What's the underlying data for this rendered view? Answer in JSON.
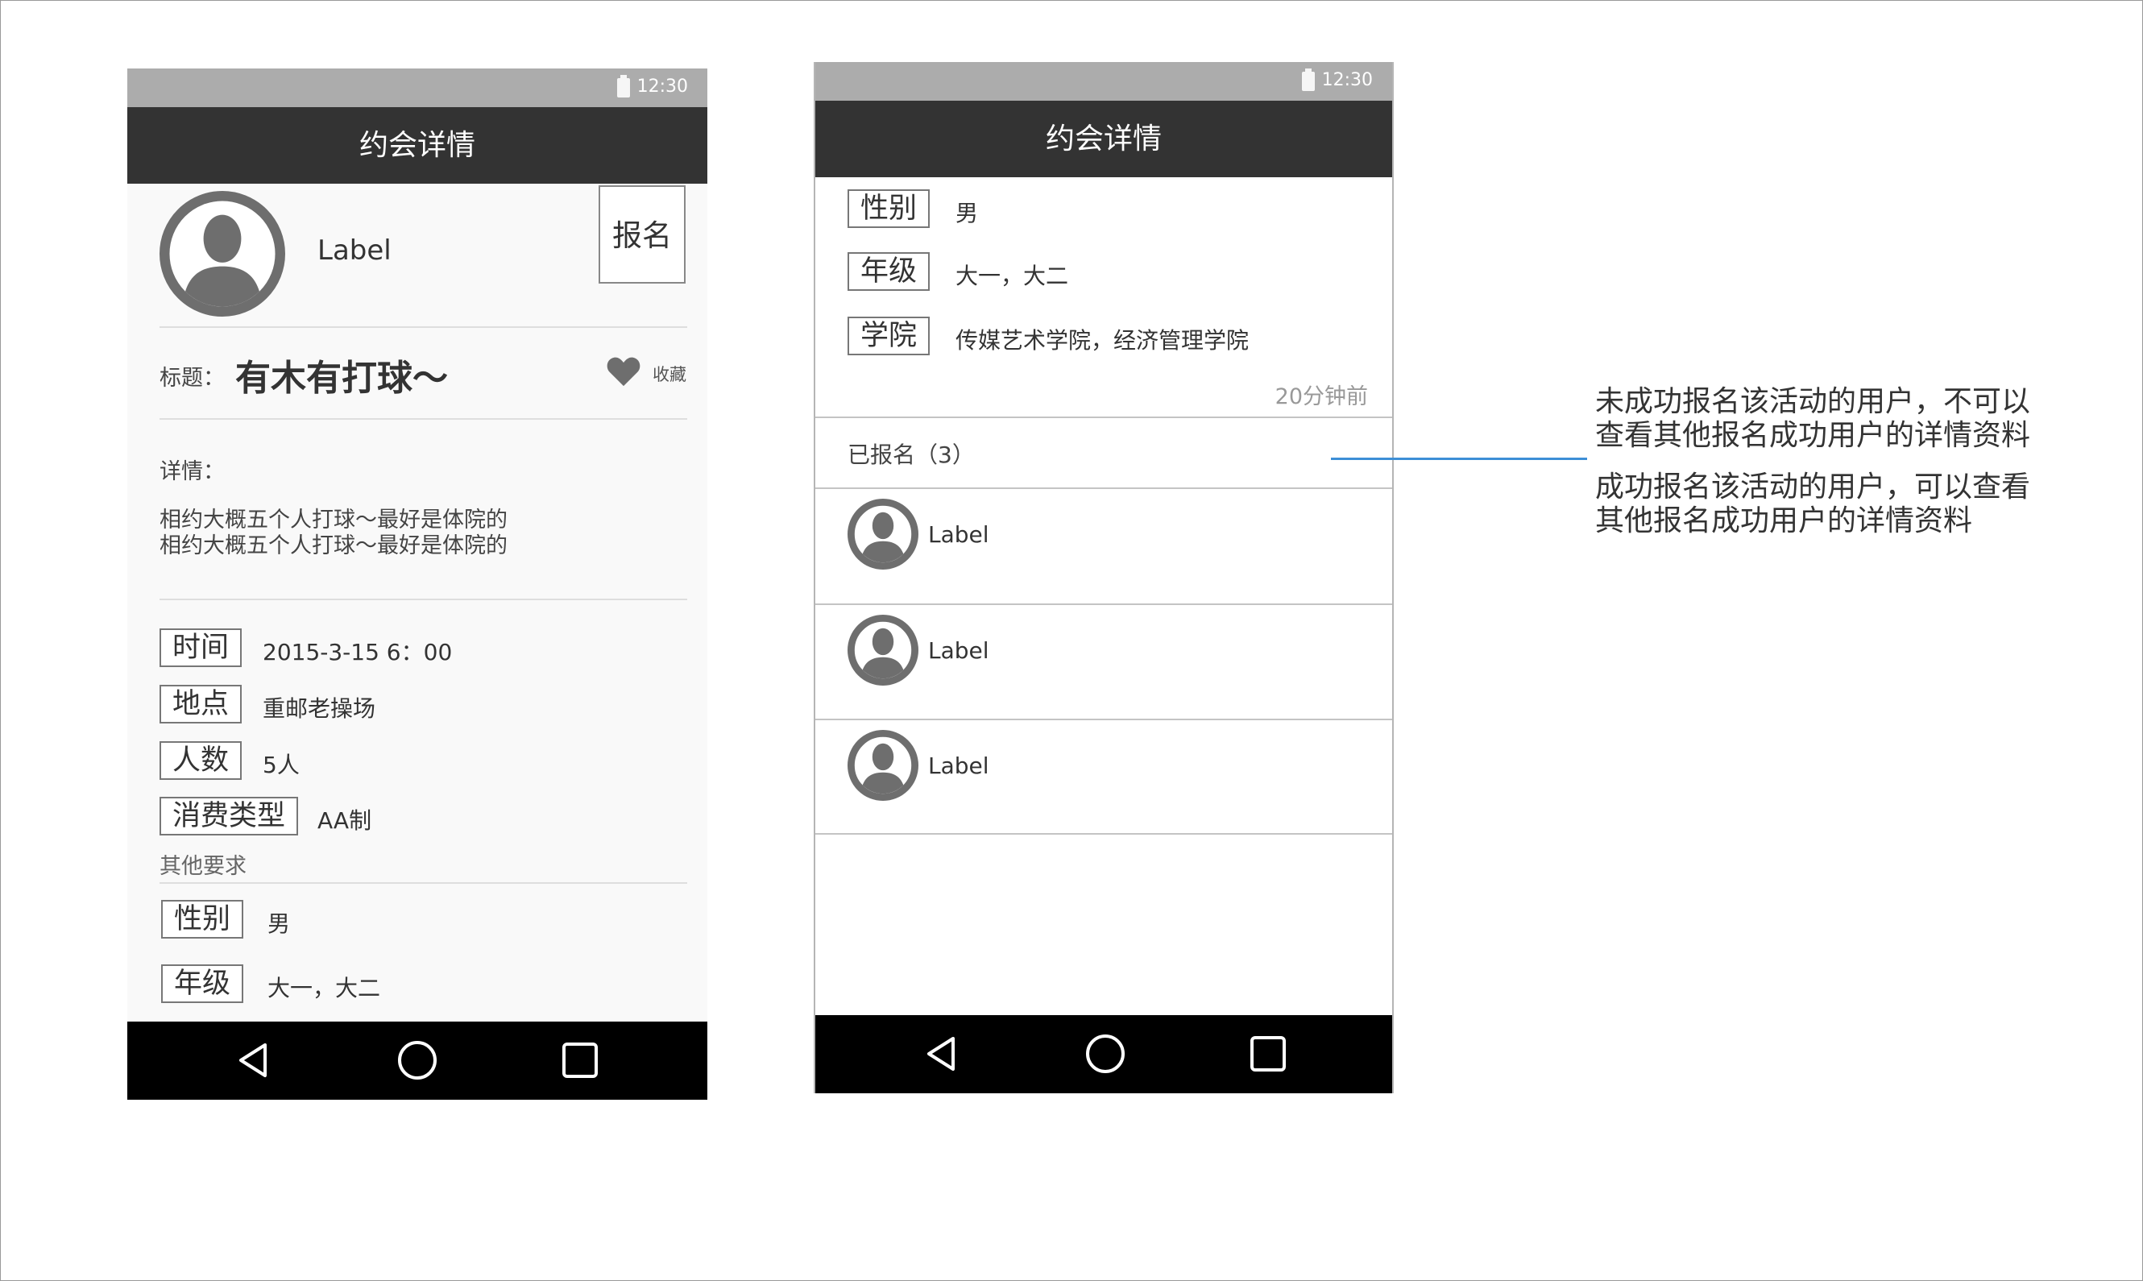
{
  "status": {
    "time": "12:30"
  },
  "screen1": {
    "title": "约会详情",
    "host_name": "Label",
    "signup_label": "报名",
    "subject_label": "标题：",
    "subject": "有木有打球～",
    "favorite_label": "收藏",
    "detail_label": "详情：",
    "detail_lines": [
      "相约大概五个人打球～最好是体院的",
      "相约大概五个人打球～最好是体院的"
    ],
    "fields": [
      {
        "label": "时间",
        "value": "2015-3-15   6：00"
      },
      {
        "label": "地点",
        "value": "重邮老操场"
      },
      {
        "label": "人数",
        "value": "5人"
      },
      {
        "label": "消费类型",
        "value": "AA制"
      }
    ],
    "other_requirements_label": "其他要求",
    "requirements": [
      {
        "label": "性别",
        "value": "男"
      },
      {
        "label": "年级",
        "value": "大一，大二"
      }
    ]
  },
  "screen2": {
    "title": "约会详情",
    "requirements": [
      {
        "label": "性别",
        "value": "男"
      },
      {
        "label": "年级",
        "value": "大一，大二"
      },
      {
        "label": "学院",
        "value": "传媒艺术学院，经济管理学院"
      }
    ],
    "time_ago": "20分钟前",
    "registered_header": "已报名（3）",
    "registrants": [
      {
        "name": "Label"
      },
      {
        "name": "Label"
      },
      {
        "name": "Label"
      }
    ]
  },
  "annotation": {
    "note1_line1": "未成功报名该活动的用户，不可以",
    "note1_line2": "查看其他报名成功用户的详情资料",
    "note2_line1": "成功报名该活动的用户，可以查看",
    "note2_line2": "其他报名成功用户的详情资料"
  },
  "colors": {
    "titlebar": "#333333",
    "statusbar": "#acacac",
    "navbar": "#000000",
    "connector": "#3d8fd6"
  },
  "icons": {
    "battery": "battery-icon",
    "avatar": "user-avatar-icon",
    "heart": "heart-icon",
    "back": "back-triangle-icon",
    "home": "home-circle-icon",
    "recents": "recents-square-icon"
  }
}
